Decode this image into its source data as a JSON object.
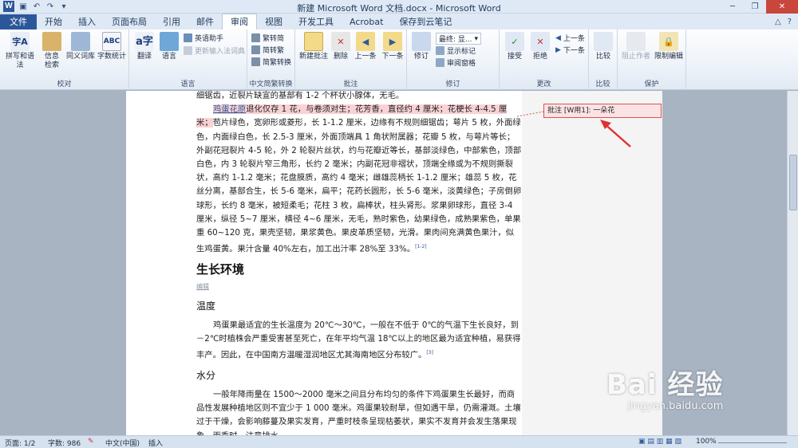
{
  "window": {
    "title": "新建 Microsoft Word 文档.docx - Microsoft Word"
  },
  "tabs": [
    "文件",
    "开始",
    "插入",
    "页面布局",
    "引用",
    "邮件",
    "审阅",
    "视图",
    "开发工具",
    "Acrobat",
    "保存到云笔记"
  ],
  "active_tab": "审阅",
  "ribbon": {
    "groups": {
      "proofing": {
        "label": "校对",
        "spelling": "拼写和语法",
        "info": "信息检索",
        "thesaurus": "同义词库",
        "wordcount": "字数统计"
      },
      "language": {
        "label": "语言",
        "translate": "翻译",
        "language": "语言",
        "english_assist": "英语助手",
        "update_ime": "更新输入法词典"
      },
      "chinese": {
        "label": "中文简繁转换",
        "to_simplified": "繁转简",
        "to_traditional": "简转繁",
        "convert": "简繁转换"
      },
      "comments": {
        "label": "批注",
        "new": "新建批注",
        "delete": "删除",
        "previous": "上一条",
        "next": "下一条"
      },
      "tracking": {
        "label": "修订",
        "track": "修订",
        "final_display": "最终: 显...",
        "show_markup": "显示标记",
        "review_pane": "审阅窗格"
      },
      "changes": {
        "label": "更改",
        "accept": "接受",
        "reject": "拒绝",
        "prev": "上一条",
        "next": "下一条"
      },
      "compare": {
        "label": "比较",
        "compare": "比较"
      },
      "protect": {
        "label": "保护",
        "block_authors": "阻止作者",
        "restrict": "限制编辑"
      }
    }
  },
  "document": {
    "line1": "细锯齿，近裂片缺宣的基部有 1-2 个杯状小腺体，无毛。",
    "para1_hl": "鸡蛋花原退化仅存 1 花，与卷须对生；花芳香，直径约 4 厘米；花梗长 4-4.5 厘米；",
    "para1_link": "鸡蛋花原",
    "para1_rest": "苞片绿色，宽卵形或菱形，长 1-1.2 厘米，边缘有不规则细锯齿；萼片 5 枚，外面绿色，内面绿白色，长 2.5-3 厘米，外面顶端具 1 角状附属器；花瓣 5 枚，与萼片等长；外副花冠裂片 4-5 轮，外 2 轮裂片丝状，约与花瓣近等长，基部淡绿色，中部紫色，顶部白色，内 3 轮裂片窄三角形，长约 2 毫米；内副花冠非褶状，顶端全缘或为不规则撕裂状，高约 1-1.2 毫米；花盘膜质，高约 4 毫米；雌雄蕊柄长 1-1.2 厘米；雄蕊 5 枚，花丝分离，基部合生，长 5-6 毫米，扁平；花药长圆形，长 5-6 毫米，淡黄绿色；子房倒卵球形，长约 8 毫米，被短柔毛；花柱 3 枚，扁棒状，柱头肾形。浆果卵球形，直径 3-4 厘米，纵径 5~7 厘米，横径 4~6 厘米，无毛，熟时紫色，幼果绿色，成熟果紫色，单果重 60~120 克，果壳坚韧，果浆黄色。果皮革质坚韧，光滑。果肉间充满黄色果汁，似生鸡蛋黄。果汁含量 40%左右，加工出汁率 28%至 33%。",
    "ref1": "[1-2]",
    "h_grow": "生长环境",
    "edit": "编辑",
    "h_temp": "温度",
    "para_temp": "鸡蛋果最适宜的生长温度为 20℃～30℃，一般在不低于 0℃的气温下生长良好，到－2℃时植株会严重受害甚至死亡，在年平均气温 18℃以上的地区最为适宜种植，易获得丰产。因此，在中国南方温暖湿润地区尤其海南地区分布较广。",
    "ref2": "[3]",
    "h_water": "水分",
    "para_water": "一般年降雨量在 1500～2000 毫米之间且分布均匀的条件下鸡蛋果生长最好，而商品性发展种植地区则不宜少于 1 000 毫米。鸡蛋果较耐旱，但如遇干旱，仍需灌溉。土壤过于干燥，会影响藤蔓及果实发育，严重时枝条呈现枯萎状，果实不发育并会发生落果现象。雨季时，注意排水。"
  },
  "comment": {
    "label": "批注 [W用1]: 一朵花"
  },
  "status": {
    "page": "页面: 1/2",
    "words": "字数: 986",
    "lang": "中文(中国)",
    "insert": "插入",
    "zoom": "100%"
  },
  "watermark": {
    "main": "Bai  经验",
    "sub": "jingyan.baidu.com"
  }
}
